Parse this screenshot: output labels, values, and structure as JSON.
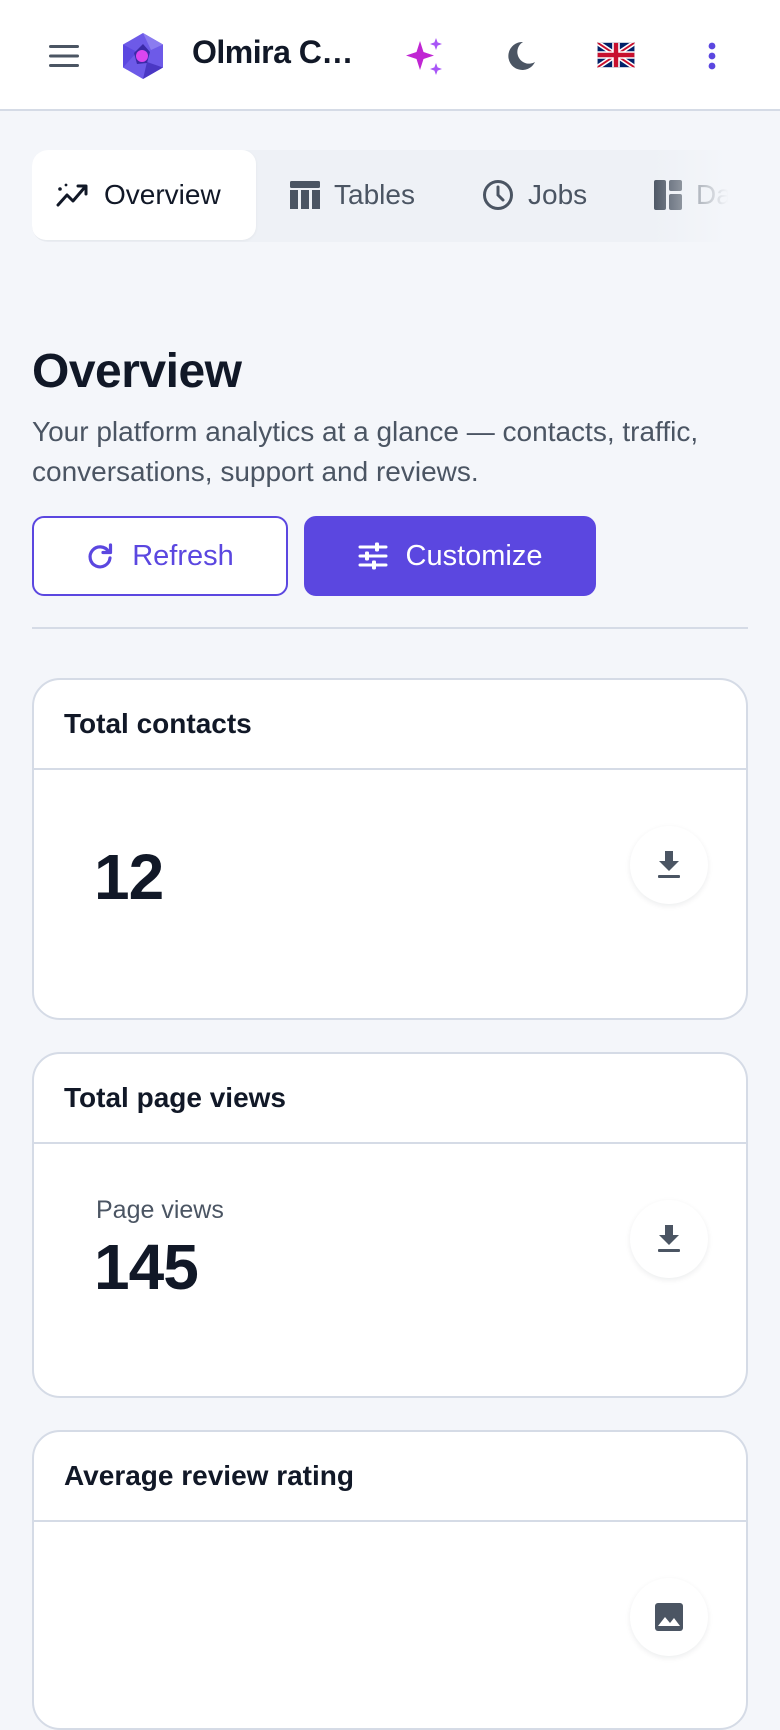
{
  "app": {
    "title": "Olmira Co…",
    "icons": {
      "menu": "menu-icon",
      "logo": "hexagon-star-logo",
      "assistant": "sparkles-icon",
      "theme": "moon-icon",
      "language": "uk-flag-icon",
      "more": "more-vertical-icon"
    },
    "colors": {
      "accent": "#5b47e0",
      "sparkle": "#c026d3",
      "text": "#111827",
      "muted": "#4b5563",
      "border": "#d5dbe6",
      "background": "#f4f6fa"
    }
  },
  "tabs": [
    {
      "label": "Overview",
      "icon": "trending-line-icon",
      "active": true
    },
    {
      "label": "Tables",
      "icon": "table-icon",
      "active": false
    },
    {
      "label": "Jobs",
      "icon": "clock-icon",
      "active": false
    },
    {
      "label": "Das",
      "icon": "dashboard-icon",
      "active": false
    }
  ],
  "page": {
    "title": "Overview",
    "subtitle": "Your platform analytics at a glance — contacts, traffic, conversations, support and reviews."
  },
  "actions": {
    "refresh_label": "Refresh",
    "customize_label": "Customize"
  },
  "cards": [
    {
      "title": "Total contacts",
      "label": "",
      "value": "12",
      "action_icon": "download-icon"
    },
    {
      "title": "Total page views",
      "label": "Page views",
      "value": "145",
      "action_icon": "download-icon"
    },
    {
      "title": "Average review rating",
      "label": "",
      "value": "",
      "action_icon": "image-icon"
    }
  ]
}
